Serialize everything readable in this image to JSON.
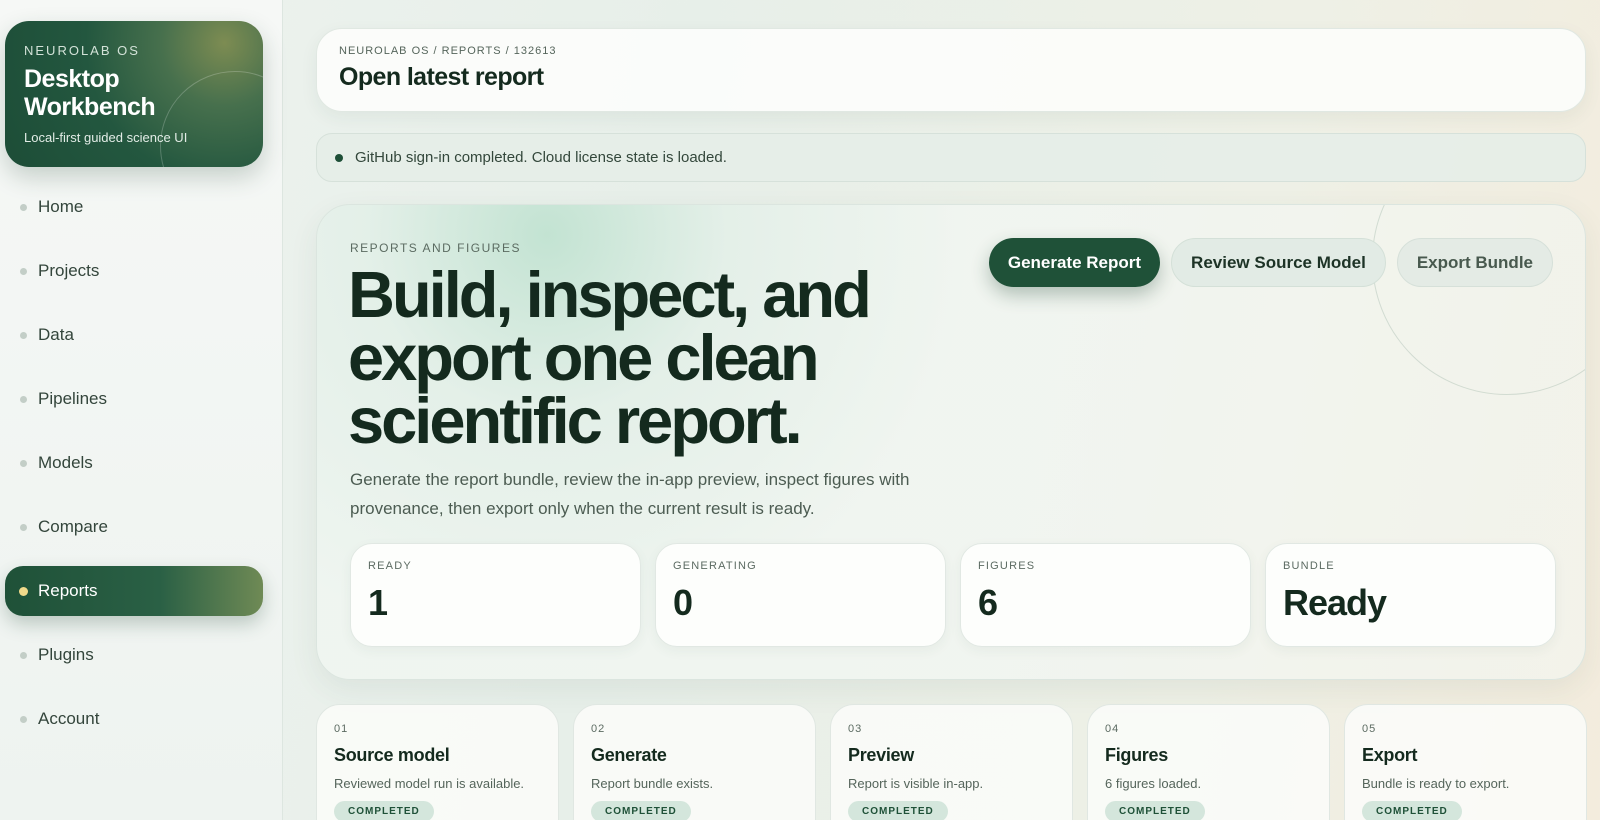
{
  "brand": {
    "eyebrow": "NEUROLAB OS",
    "title": "Desktop Workbench",
    "subtitle": "Local-first guided science UI"
  },
  "sidebar": {
    "items": [
      {
        "label": "Home",
        "active": false
      },
      {
        "label": "Projects",
        "active": false
      },
      {
        "label": "Data",
        "active": false
      },
      {
        "label": "Pipelines",
        "active": false
      },
      {
        "label": "Models",
        "active": false
      },
      {
        "label": "Compare",
        "active": false
      },
      {
        "label": "Reports",
        "active": true
      },
      {
        "label": "Plugins",
        "active": false
      },
      {
        "label": "Account",
        "active": false
      }
    ]
  },
  "header": {
    "breadcrumb": "NEUROLAB OS / REPORTS / 132613",
    "title": "Open latest report"
  },
  "status": {
    "message": "GitHub sign-in completed. Cloud license state is loaded."
  },
  "hero": {
    "eyebrow": "REPORTS AND FIGURES",
    "title": "Build, inspect, and export one clean scientific report.",
    "description": "Generate the report bundle, review the in-app preview, inspect figures with provenance, then export only when the current result is ready.",
    "actions": {
      "generate": "Generate Report",
      "review": "Review Source Model",
      "export": "Export Bundle"
    },
    "stats": [
      {
        "label": "READY",
        "value": "1"
      },
      {
        "label": "GENERATING",
        "value": "0"
      },
      {
        "label": "FIGURES",
        "value": "6"
      },
      {
        "label": "BUNDLE",
        "value": "Ready"
      }
    ]
  },
  "steps": [
    {
      "num": "01",
      "title": "Source model",
      "desc": "Reviewed model run is available.",
      "badge": "COMPLETED"
    },
    {
      "num": "02",
      "title": "Generate",
      "desc": "Report bundle exists.",
      "badge": "COMPLETED"
    },
    {
      "num": "03",
      "title": "Preview",
      "desc": "Report is visible in-app.",
      "badge": "COMPLETED"
    },
    {
      "num": "04",
      "title": "Figures",
      "desc": "6 figures loaded.",
      "badge": "COMPLETED"
    },
    {
      "num": "05",
      "title": "Export",
      "desc": "Bundle is ready to export.",
      "badge": "COMPLETED"
    }
  ],
  "colors": {
    "accent": "#1f5138",
    "active_dot": "#f0d98a",
    "text": "#142a1e"
  }
}
